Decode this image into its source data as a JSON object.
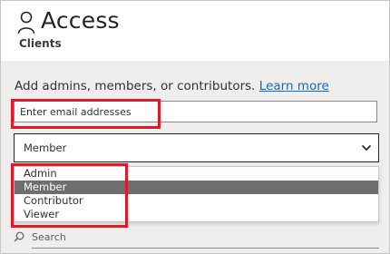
{
  "header": {
    "title": "Access",
    "subtitle": "Clients",
    "icon": "person-icon"
  },
  "panel": {
    "instruction": "Add admins, members, or contributors.",
    "learn_more": "Learn more",
    "email_placeholder": "Enter email addresses",
    "role_select": {
      "value": "Member",
      "icon": "chevron-down-icon"
    },
    "role_options": [
      {
        "label": "Admin",
        "selected": false
      },
      {
        "label": "Member",
        "selected": true
      },
      {
        "label": "Contributor",
        "selected": false
      },
      {
        "label": "Viewer",
        "selected": false
      }
    ],
    "search_placeholder": "Search",
    "search_icon": "search-icon"
  },
  "colors": {
    "highlight": "#e0192a",
    "link": "#0f6cbd",
    "selected_option": "#6e6e6e",
    "panel_background": "#efeeed"
  }
}
